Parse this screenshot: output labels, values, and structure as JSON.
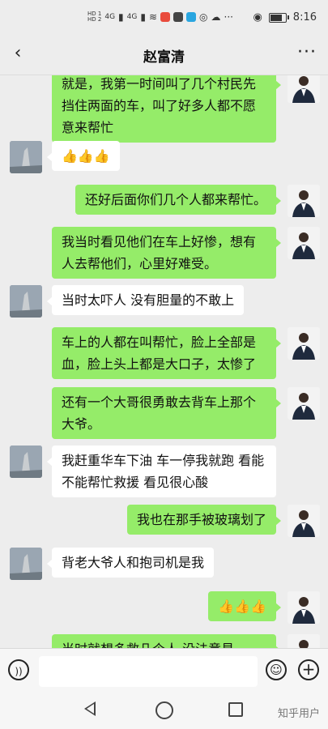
{
  "status_bar": {
    "hd_top": "HD 1",
    "hd_bottom": "HD 2",
    "signal1": "4G",
    "signal2": "4G",
    "time": "8:16"
  },
  "header": {
    "back_icon": "chevron-left",
    "title": "赵富清",
    "more_icon": "ellipsis"
  },
  "messages": [
    {
      "side": "right",
      "text": "就是，我第一时间叫了几个村民先挡住两面的车，叫了好多人都不愿意来帮忙"
    },
    {
      "side": "left",
      "text": "👍👍👍"
    },
    {
      "side": "right",
      "text": "还好后面你们几个人都来帮忙。"
    },
    {
      "side": "right",
      "text": "我当时看见他们在车上好惨，想有人去帮他们，心里好难受。"
    },
    {
      "side": "left",
      "text": "当时太吓人  没有胆量的不敢上"
    },
    {
      "side": "right",
      "text": "车上的人都在叫帮忙，脸上全部是血，脸上头上都是大口子，太惨了"
    },
    {
      "side": "right",
      "text": "还有一个大哥很勇敢去背车上那个大爷。"
    },
    {
      "side": "left",
      "text": "我赶重华车下油  车一停我就跑  看能不能帮忙救援  看见很心酸"
    },
    {
      "side": "right",
      "text": "我也在那手被玻璃划了"
    },
    {
      "side": "left",
      "text": "背老大爷人和抱司机是我"
    },
    {
      "side": "right",
      "text": "👍👍👍"
    },
    {
      "side": "right",
      "text": "当时就想多救几个人  没法意見"
    }
  ],
  "input_bar": {
    "voice_icon": "voice-wave",
    "emoji_icon": "smiley",
    "plus_icon": "plus"
  },
  "nav_bar": {
    "back_icon": "triangle-back",
    "home_icon": "circle-home",
    "recent_icon": "square-recent",
    "watermark": "知乎用户"
  }
}
